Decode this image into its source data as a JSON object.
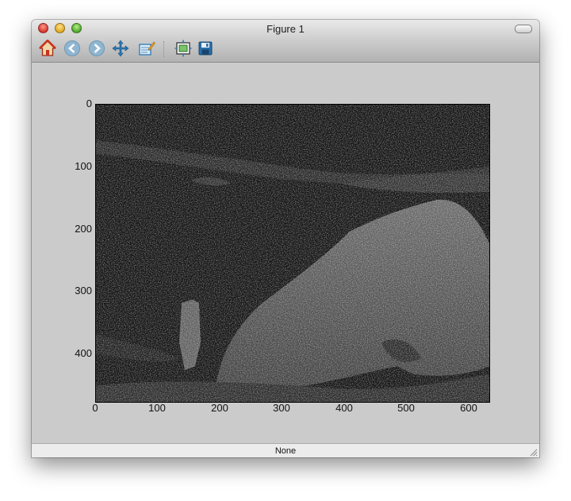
{
  "window": {
    "title": "Figure 1"
  },
  "toolbar": {
    "tools": [
      {
        "name": "home-icon",
        "label": "Home"
      },
      {
        "name": "back-icon",
        "label": "Back"
      },
      {
        "name": "forward-icon",
        "label": "Forward"
      },
      {
        "name": "pan-icon",
        "label": "Pan"
      },
      {
        "name": "zoom-icon",
        "label": "Zoom"
      },
      {
        "name": "subplots-icon",
        "label": "Configure subplots"
      },
      {
        "name": "save-icon",
        "label": "Save"
      }
    ]
  },
  "axes": {
    "y_ticks": [
      "0",
      "100",
      "200",
      "300",
      "400"
    ],
    "x_ticks": [
      "0",
      "100",
      "200",
      "300",
      "400",
      "500",
      "600"
    ]
  },
  "status": {
    "text": "None"
  },
  "colors": {
    "window_bg": "#cbcbcb",
    "image_bg": "#131313",
    "toolbar_icon_blue": "#2b7ab8"
  }
}
